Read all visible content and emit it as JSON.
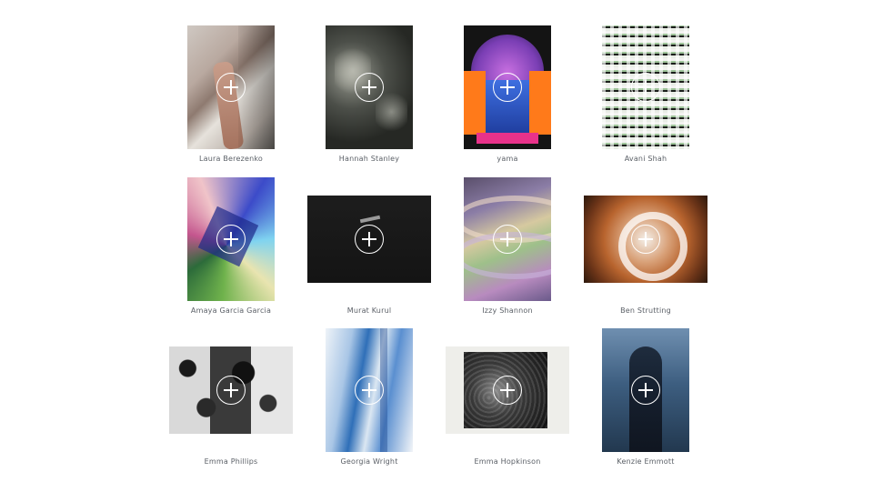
{
  "gallery": {
    "artists": [
      {
        "name": "Laura Berezenko",
        "icon": "plus-circle-icon"
      },
      {
        "name": "Hannah Stanley",
        "icon": "plus-circle-icon"
      },
      {
        "name": "yama",
        "icon": "plus-circle-icon"
      },
      {
        "name": "Avani Shah",
        "icon": "plus-circle-icon"
      },
      {
        "name": "Amaya Garcia Garcia",
        "icon": "plus-circle-icon"
      },
      {
        "name": "Murat Kurul",
        "icon": "plus-circle-icon"
      },
      {
        "name": "Izzy Shannon",
        "icon": "plus-circle-icon"
      },
      {
        "name": "Ben Strutting",
        "icon": "plus-circle-icon"
      },
      {
        "name": "Emma Phillips",
        "icon": "plus-circle-icon"
      },
      {
        "name": "Georgia Wright",
        "icon": "plus-circle-icon"
      },
      {
        "name": "Emma Hopkinson",
        "icon": "plus-circle-icon"
      },
      {
        "name": "Kenzie Emmott",
        "icon": "plus-circle-icon"
      }
    ]
  },
  "colors": {
    "caption": "#5a5f66",
    "background": "#ffffff",
    "overlay_icon": "#ffffff"
  }
}
